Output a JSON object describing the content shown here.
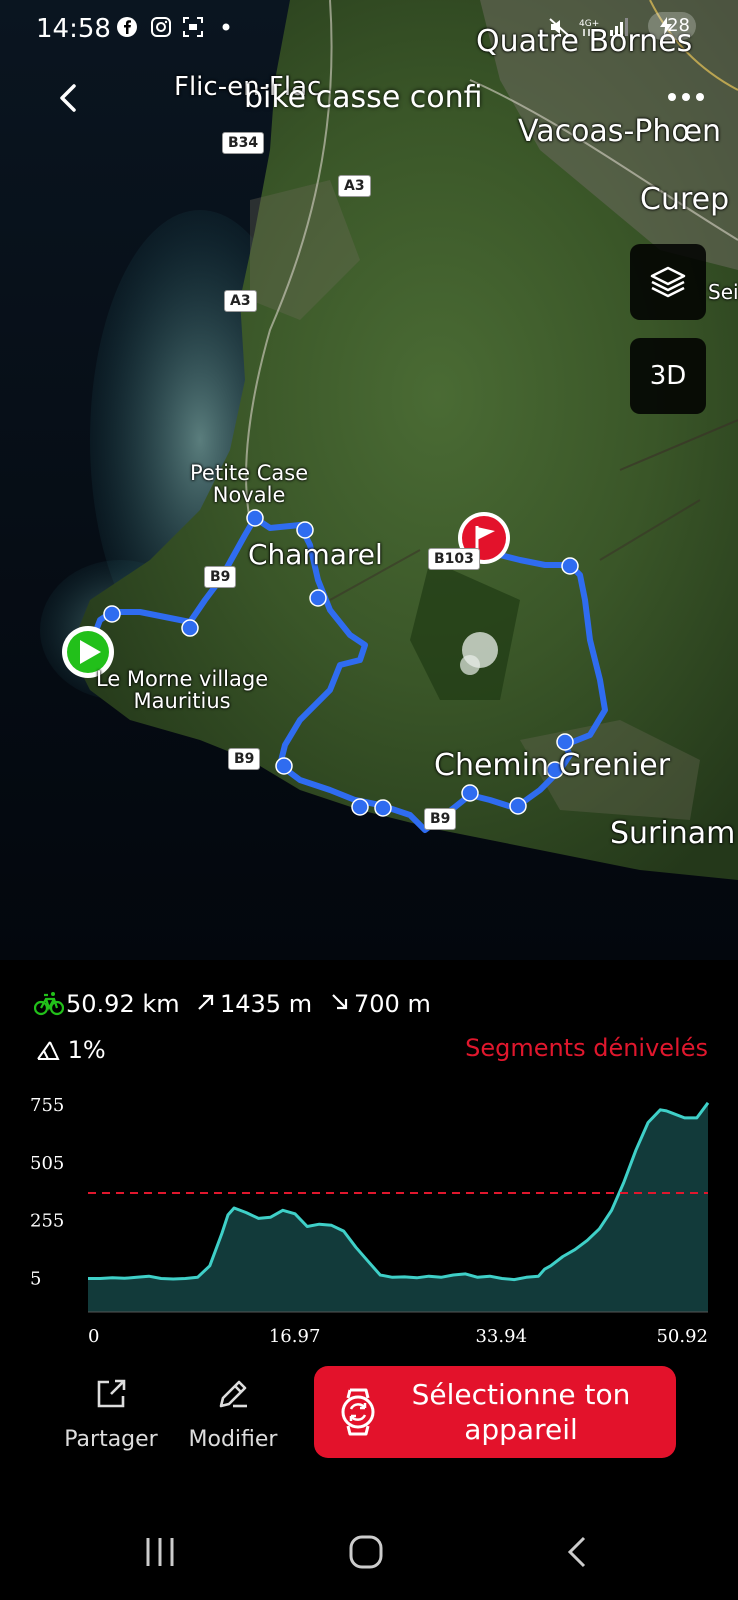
{
  "status_bar": {
    "time": "14:58",
    "battery": "28",
    "icons": [
      "facebook-icon",
      "instagram-icon",
      "screenshot-icon",
      "dot-icon",
      "mute-icon",
      "4g-icon",
      "signal-icon",
      "battery-icon"
    ]
  },
  "header": {
    "title": "bike casse confi"
  },
  "map": {
    "labels": {
      "quatre_bornes": "Quatre Bornes",
      "flic_en_flac": "Flic-en-Flac",
      "vacoas": "Vacoas-Phœn",
      "curepipe": "Curep",
      "sei": "Sei",
      "petite_case_novale": "Petite Case\nNovale",
      "chamarel": "Chamarel",
      "le_morne": "Le Morne village\nMauritius",
      "chemin_grenier": "Chemin Grenier",
      "surinam": "Surinam"
    },
    "roads": {
      "b34": "B34",
      "a3_top": "A3",
      "a3_mid": "A3",
      "b9_north": "B9",
      "b9_west": "B9",
      "b9_south": "B9",
      "b103": "B103"
    },
    "buttons": {
      "layers_icon": "layers-icon",
      "btn_3d": "3D"
    },
    "colors": {
      "route": "#2f6cf0",
      "start": "#22c01a",
      "finish": "#e3122b"
    }
  },
  "stats": {
    "distance": "50.92 km",
    "ascent": "1435 m",
    "descent": "700 m",
    "grade": "1%",
    "segments_link": "Segments dénivelés"
  },
  "chart_data": {
    "type": "area",
    "title": "",
    "xlabel": "",
    "ylabel": "",
    "x_ticks": [
      "0",
      "16.97",
      "33.94",
      "50.92"
    ],
    "y_ticks": [
      "755",
      "505",
      "255",
      "5"
    ],
    "xlim": [
      0,
      50.92
    ],
    "ylim": [
      -140,
      760
    ],
    "threshold_line": 375,
    "line_color": "#3fd0c8",
    "fill_color": "#123a3a",
    "threshold_color": "#e0172d",
    "series": [
      {
        "x": [
          0,
          1,
          2,
          3,
          4,
          5,
          6,
          7,
          8,
          9,
          10,
          11,
          11.5,
          12,
          13,
          14,
          15,
          16,
          17,
          18,
          19,
          20,
          21,
          22,
          23,
          24,
          25,
          26,
          27,
          28,
          29,
          30,
          31,
          32,
          33,
          34,
          35,
          36,
          37,
          37.5,
          38,
          39,
          40,
          41,
          42,
          43,
          44,
          45,
          46,
          47,
          47.5,
          48,
          49,
          50,
          50.92
        ],
        "y": [
          5,
          5,
          8,
          6,
          10,
          15,
          5,
          3,
          5,
          10,
          60,
          200,
          280,
          310,
          290,
          265,
          270,
          300,
          285,
          230,
          240,
          235,
          210,
          140,
          80,
          20,
          10,
          12,
          8,
          15,
          10,
          20,
          25,
          10,
          15,
          5,
          0,
          10,
          15,
          45,
          60,
          100,
          130,
          170,
          220,
          300,
          420,
          560,
          680,
          735,
          730,
          720,
          700,
          700,
          765
        ]
      }
    ]
  },
  "actions": {
    "share": "Partager",
    "edit": "Modifier",
    "select_device": "Sélectionne ton\nappareil"
  }
}
